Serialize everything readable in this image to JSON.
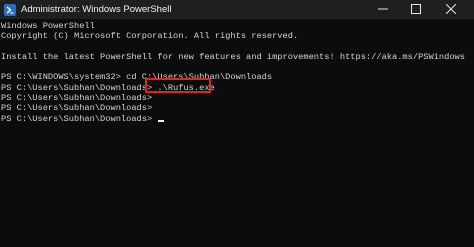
{
  "window": {
    "title": "Administrator: Windows PowerShell",
    "app_icon": "powershell-icon",
    "controls": {
      "minimize_icon": "minimize-icon",
      "maximize_icon": "maximize-icon",
      "close_icon": "close-icon"
    }
  },
  "console": {
    "lines": [
      "Windows PowerShell",
      "Copyright (C) Microsoft Corporation. All rights reserved.",
      "",
      "Install the latest PowerShell for new features and improvements! https://aka.ms/PSWindows",
      "",
      "PS C:\\WINDOWS\\system32> cd C:\\Users\\Subhan\\Downloads",
      "PS C:\\Users\\Subhan\\Downloads> .\\Rufus.exe",
      "PS C:\\Users\\Subhan\\Downloads>",
      "PS C:\\Users\\Subhan\\Downloads>",
      "PS C:\\Users\\Subhan\\Downloads> "
    ],
    "highlighted_command": ".\\Rufus.exe",
    "highlight_color": "#e02424",
    "text_color": "#d4d4d4",
    "background_color": "#0c0c0c"
  }
}
